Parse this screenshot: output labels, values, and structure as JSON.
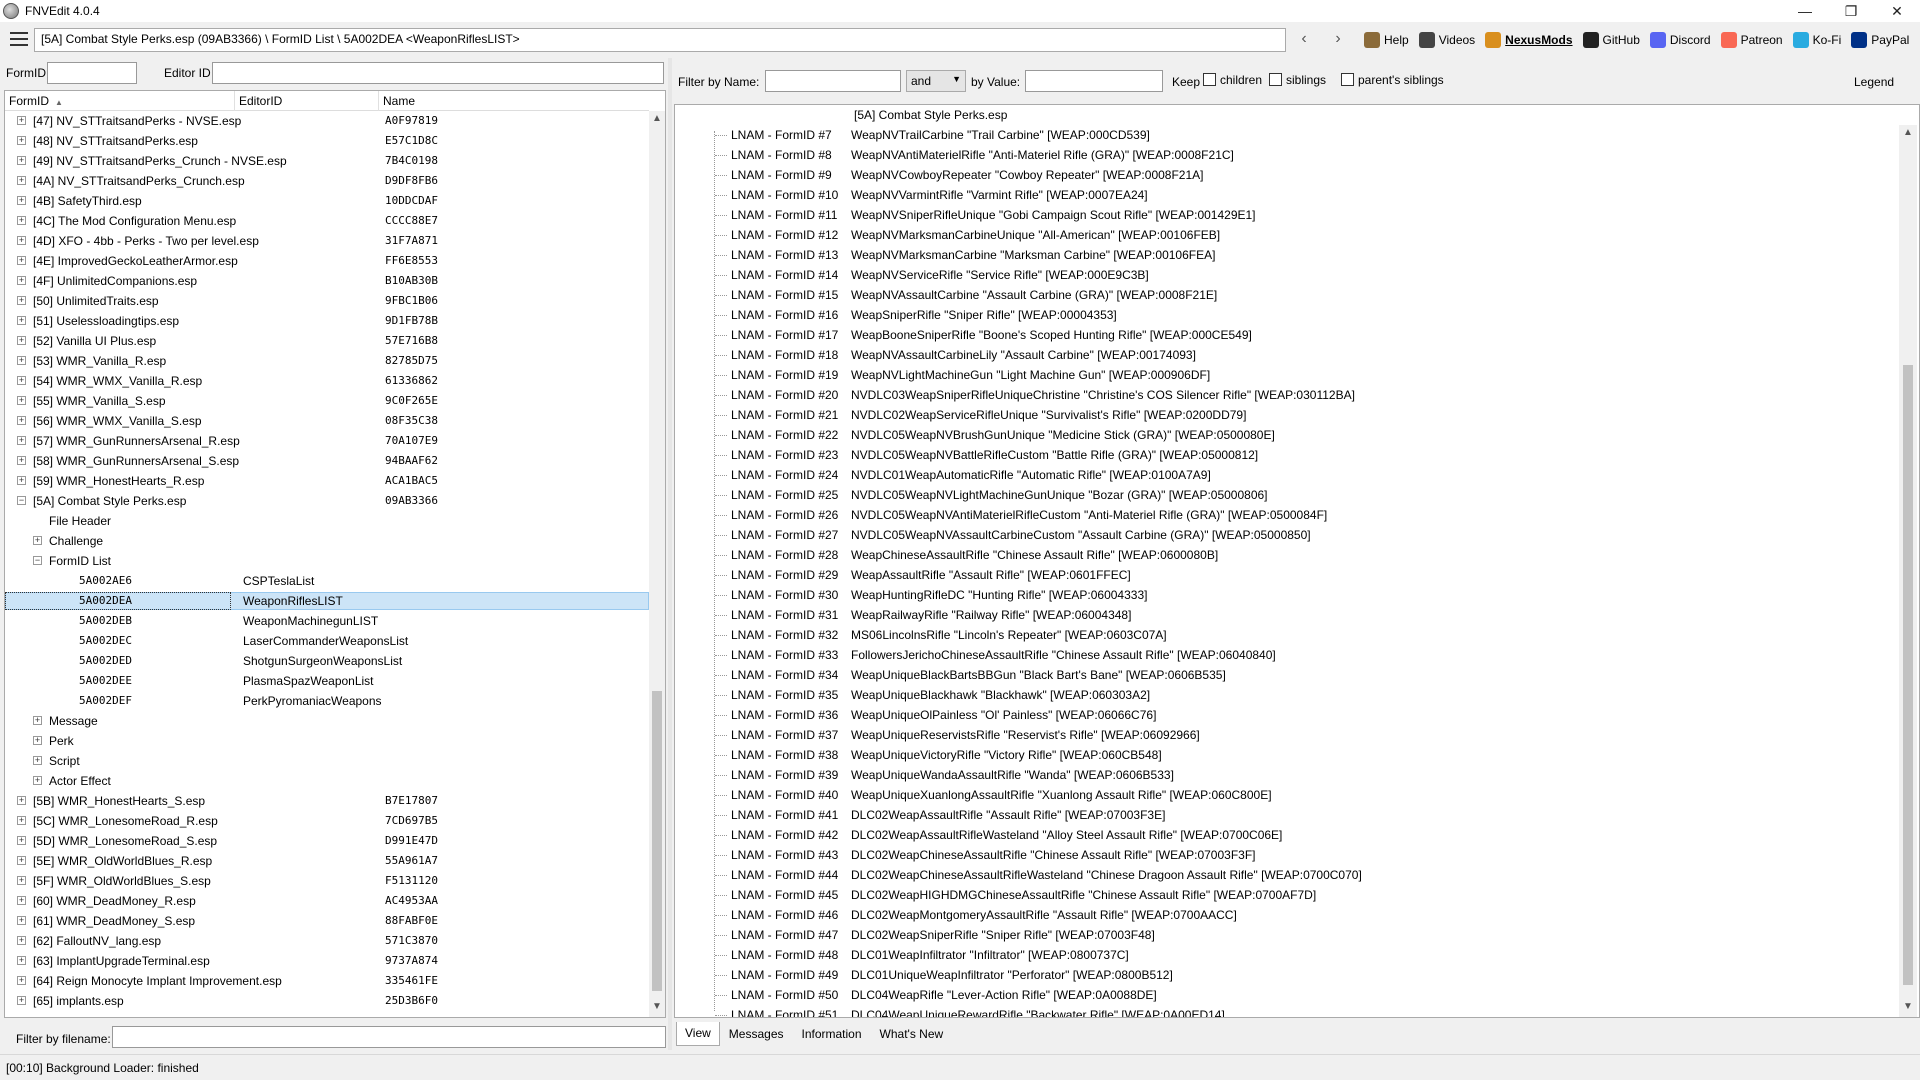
{
  "window": {
    "title": "FNVEdit 4.0.4",
    "controls": [
      "—",
      "❐",
      "✕"
    ]
  },
  "toolbar": {
    "path": "[5A] Combat Style Perks.esp (09AB3366) \\ FormID List \\ 5A002DEA <WeaponRiflesLIST>",
    "back": "‹",
    "forward": "›",
    "links": [
      {
        "label": "Help",
        "icon": "book-icon",
        "color": "#8b6b3a"
      },
      {
        "label": "Videos",
        "icon": "film-icon",
        "color": "#444444"
      },
      {
        "label": "NexusMods",
        "icon": "nexus-icon",
        "color": "#d98f1e"
      },
      {
        "label": "GitHub",
        "icon": "github-icon",
        "color": "#222222"
      },
      {
        "label": "Discord",
        "icon": "discord-icon",
        "color": "#5865f2"
      },
      {
        "label": "Patreon",
        "icon": "patreon-icon",
        "color": "#f96854"
      },
      {
        "label": "Ko-Fi",
        "icon": "kofi-icon",
        "color": "#29abe0"
      },
      {
        "label": "PayPal",
        "icon": "paypal-icon",
        "color": "#003087"
      }
    ]
  },
  "left": {
    "formid_label": "FormID",
    "editorid_label": "Editor ID",
    "columns": [
      "FormID",
      "EditorID",
      "Name"
    ],
    "filter_label": "Filter by filename:",
    "rows": [
      {
        "lvl": 0,
        "exp": "+",
        "text": "[47] NV_STTraitsandPerks - NVSE.esp",
        "val": "A0F97819"
      },
      {
        "lvl": 0,
        "exp": "+",
        "text": "[48] NV_STTraitsandPerks.esp",
        "val": "E57C1D8C"
      },
      {
        "lvl": 0,
        "exp": "+",
        "text": "[49] NV_STTraitsandPerks_Crunch - NVSE.esp",
        "val": "7B4C0198"
      },
      {
        "lvl": 0,
        "exp": "+",
        "text": "[4A] NV_STTraitsandPerks_Crunch.esp",
        "val": "D9DF8FB6"
      },
      {
        "lvl": 0,
        "exp": "+",
        "text": "[4B] SafetyThird.esp",
        "val": "10DDCDAF"
      },
      {
        "lvl": 0,
        "exp": "+",
        "text": "[4C] The Mod Configuration Menu.esp",
        "val": "CCCC88E7"
      },
      {
        "lvl": 0,
        "exp": "+",
        "text": "[4D] XFO - 4bb - Perks - Two per level.esp",
        "val": "31F7A871"
      },
      {
        "lvl": 0,
        "exp": "+",
        "text": "[4E] ImprovedGeckoLeatherArmor.esp",
        "val": "FF6E8553"
      },
      {
        "lvl": 0,
        "exp": "+",
        "text": "[4F] UnlimitedCompanions.esp",
        "val": "B10AB30B"
      },
      {
        "lvl": 0,
        "exp": "+",
        "text": "[50] UnlimitedTraits.esp",
        "val": "9FBC1B06"
      },
      {
        "lvl": 0,
        "exp": "+",
        "text": "[51] Uselessloadingtips.esp",
        "val": "9D1FB78B"
      },
      {
        "lvl": 0,
        "exp": "+",
        "text": "[52] Vanilla UI Plus.esp",
        "val": "57E716B8"
      },
      {
        "lvl": 0,
        "exp": "+",
        "text": "[53] WMR_Vanilla_R.esp",
        "val": "82785D75"
      },
      {
        "lvl": 0,
        "exp": "+",
        "text": "[54] WMR_WMX_Vanilla_R.esp",
        "val": "61336862"
      },
      {
        "lvl": 0,
        "exp": "+",
        "text": "[55] WMR_Vanilla_S.esp",
        "val": "9C0F265E"
      },
      {
        "lvl": 0,
        "exp": "+",
        "text": "[56] WMR_WMX_Vanilla_S.esp",
        "val": "08F35C38"
      },
      {
        "lvl": 0,
        "exp": "+",
        "text": "[57] WMR_GunRunnersArsenal_R.esp",
        "val": "70A107E9"
      },
      {
        "lvl": 0,
        "exp": "+",
        "text": "[58] WMR_GunRunnersArsenal_S.esp",
        "val": "94BAAF62"
      },
      {
        "lvl": 0,
        "exp": "+",
        "text": "[59] WMR_HonestHearts_R.esp",
        "val": "ACA1BAC5"
      },
      {
        "lvl": 0,
        "exp": "−",
        "text": "[5A] Combat Style Perks.esp",
        "val": "09AB3366"
      },
      {
        "lvl": 1,
        "exp": "",
        "text": "File Header",
        "val": ""
      },
      {
        "lvl": 1,
        "exp": "+",
        "text": "Challenge",
        "val": ""
      },
      {
        "lvl": 1,
        "exp": "−",
        "text": "FormID List",
        "val": ""
      },
      {
        "lvl": 2,
        "exp": "",
        "text": "5A002AE6",
        "eid": "CSPTeslaList",
        "val": "",
        "mono": true
      },
      {
        "lvl": 2,
        "exp": "",
        "text": "5A002DEA",
        "eid": "WeaponRiflesLIST",
        "val": "",
        "mono": true,
        "sel": true
      },
      {
        "lvl": 2,
        "exp": "",
        "text": "5A002DEB",
        "eid": "WeaponMachinegunLIST",
        "val": "",
        "mono": true
      },
      {
        "lvl": 2,
        "exp": "",
        "text": "5A002DEC",
        "eid": "LaserCommanderWeaponsList",
        "val": "",
        "mono": true
      },
      {
        "lvl": 2,
        "exp": "",
        "text": "5A002DED",
        "eid": "ShotgunSurgeonWeaponsList",
        "val": "",
        "mono": true
      },
      {
        "lvl": 2,
        "exp": "",
        "text": "5A002DEE",
        "eid": "PlasmaSpazWeaponList",
        "val": "",
        "mono": true
      },
      {
        "lvl": 2,
        "exp": "",
        "text": "5A002DEF",
        "eid": "PerkPyromaniacWeapons",
        "val": "",
        "mono": true
      },
      {
        "lvl": 1,
        "exp": "+",
        "text": "Message",
        "val": ""
      },
      {
        "lvl": 1,
        "exp": "+",
        "text": "Perk",
        "val": ""
      },
      {
        "lvl": 1,
        "exp": "+",
        "text": "Script",
        "val": ""
      },
      {
        "lvl": 1,
        "exp": "+",
        "text": "Actor Effect",
        "val": ""
      },
      {
        "lvl": 0,
        "exp": "+",
        "text": "[5B] WMR_HonestHearts_S.esp",
        "val": "B7E17807"
      },
      {
        "lvl": 0,
        "exp": "+",
        "text": "[5C] WMR_LonesomeRoad_R.esp",
        "val": "7CD697B5"
      },
      {
        "lvl": 0,
        "exp": "+",
        "text": "[5D] WMR_LonesomeRoad_S.esp",
        "val": "D991E47D"
      },
      {
        "lvl": 0,
        "exp": "+",
        "text": "[5E] WMR_OldWorldBlues_R.esp",
        "val": "55A961A7"
      },
      {
        "lvl": 0,
        "exp": "+",
        "text": "[5F] WMR_OldWorldBlues_S.esp",
        "val": "F5131120"
      },
      {
        "lvl": 0,
        "exp": "+",
        "text": "[60] WMR_DeadMoney_R.esp",
        "val": "AC4953AA"
      },
      {
        "lvl": 0,
        "exp": "+",
        "text": "[61] WMR_DeadMoney_S.esp",
        "val": "88FABF0E"
      },
      {
        "lvl": 0,
        "exp": "+",
        "text": "[62] FalloutNV_lang.esp",
        "val": "571C3870"
      },
      {
        "lvl": 0,
        "exp": "+",
        "text": "[63] ImplantUpgradeTerminal.esp",
        "val": "9737A874"
      },
      {
        "lvl": 0,
        "exp": "+",
        "text": "[64] Reign Monocyte Implant Improvement.esp",
        "val": "335461FE"
      },
      {
        "lvl": 0,
        "exp": "+",
        "text": "[65] implants.esp",
        "val": "25D3B6F0"
      }
    ]
  },
  "right": {
    "filter_name_label": "Filter by Name:",
    "and_value": "and",
    "filter_value_label": "by Value:",
    "keep_label": "Keep",
    "chk_children": "children",
    "chk_siblings": "siblings",
    "chk_parents": "parent's siblings",
    "legend": "Legend",
    "header": "[5A] Combat Style Perks.esp",
    "rows": [
      {
        "k": "LNAM - FormID #7",
        "v": "WeapNVTrailCarbine \"Trail Carbine\" [WEAP:000CD539]"
      },
      {
        "k": "LNAM - FormID #8",
        "v": "WeapNVAntiMaterielRifle \"Anti-Materiel Rifle (GRA)\" [WEAP:0008F21C]"
      },
      {
        "k": "LNAM - FormID #9",
        "v": "WeapNVCowboyRepeater \"Cowboy Repeater\" [WEAP:0008F21A]"
      },
      {
        "k": "LNAM - FormID #10",
        "v": "WeapNVVarmintRifle \"Varmint Rifle\" [WEAP:0007EA24]"
      },
      {
        "k": "LNAM - FormID #11",
        "v": "WeapNVSniperRifleUnique \"Gobi Campaign Scout Rifle\" [WEAP:001429E1]"
      },
      {
        "k": "LNAM - FormID #12",
        "v": "WeapNVMarksmanCarbineUnique \"All-American\" [WEAP:00106FEB]"
      },
      {
        "k": "LNAM - FormID #13",
        "v": "WeapNVMarksmanCarbine \"Marksman Carbine\" [WEAP:00106FEA]"
      },
      {
        "k": "LNAM - FormID #14",
        "v": "WeapNVServiceRifle \"Service Rifle\" [WEAP:000E9C3B]"
      },
      {
        "k": "LNAM - FormID #15",
        "v": "WeapNVAssaultCarbine \"Assault Carbine (GRA)\" [WEAP:0008F21E]"
      },
      {
        "k": "LNAM - FormID #16",
        "v": "WeapSniperRifle \"Sniper Rifle\" [WEAP:00004353]"
      },
      {
        "k": "LNAM - FormID #17",
        "v": "WeapBooneSniperRifle \"Boone's Scoped Hunting Rifle\" [WEAP:000CE549]"
      },
      {
        "k": "LNAM - FormID #18",
        "v": "WeapNVAssaultCarbineLily \"Assault Carbine\" [WEAP:00174093]"
      },
      {
        "k": "LNAM - FormID #19",
        "v": "WeapNVLightMachineGun \"Light Machine Gun\" [WEAP:000906DF]"
      },
      {
        "k": "LNAM - FormID #20",
        "v": "NVDLC03WeapSniperRifleUniqueChristine \"Christine's COS Silencer Rifle\" [WEAP:030112BA]"
      },
      {
        "k": "LNAM - FormID #21",
        "v": "NVDLC02WeapServiceRifleUnique \"Survivalist's Rifle\" [WEAP:0200DD79]"
      },
      {
        "k": "LNAM - FormID #22",
        "v": "NVDLC05WeapNVBrushGunUnique \"Medicine Stick (GRA)\" [WEAP:0500080E]"
      },
      {
        "k": "LNAM - FormID #23",
        "v": "NVDLC05WeapNVBattleRifleCustom \"Battle Rifle (GRA)\" [WEAP:05000812]"
      },
      {
        "k": "LNAM - FormID #24",
        "v": "NVDLC01WeapAutomaticRifle \"Automatic Rifle\" [WEAP:0100A7A9]"
      },
      {
        "k": "LNAM - FormID #25",
        "v": "NVDLC05WeapNVLightMachineGunUnique \"Bozar (GRA)\" [WEAP:05000806]"
      },
      {
        "k": "LNAM - FormID #26",
        "v": "NVDLC05WeapNVAntiMaterielRifleCustom \"Anti-Materiel Rifle (GRA)\" [WEAP:0500084F]"
      },
      {
        "k": "LNAM - FormID #27",
        "v": "NVDLC05WeapNVAssaultCarbineCustom \"Assault Carbine (GRA)\" [WEAP:05000850]"
      },
      {
        "k": "LNAM - FormID #28",
        "v": "WeapChineseAssaultRifle \"Chinese Assault Rifle\" [WEAP:0600080B]"
      },
      {
        "k": "LNAM - FormID #29",
        "v": "WeapAssaultRifle \"Assault Rifle\" [WEAP:0601FFEC]"
      },
      {
        "k": "LNAM - FormID #30",
        "v": "WeapHuntingRifleDC \"Hunting Rifle\" [WEAP:06004333]"
      },
      {
        "k": "LNAM - FormID #31",
        "v": "WeapRailwayRifle \"Railway Rifle\" [WEAP:06004348]"
      },
      {
        "k": "LNAM - FormID #32",
        "v": "MS06LincolnsRifle \"Lincoln's Repeater\" [WEAP:0603C07A]"
      },
      {
        "k": "LNAM - FormID #33",
        "v": "FollowersJerichoChineseAssaultRifle \"Chinese Assault Rifle\" [WEAP:06040840]"
      },
      {
        "k": "LNAM - FormID #34",
        "v": "WeapUniqueBlackBartsBBGun \"Black Bart's Bane\" [WEAP:0606B535]"
      },
      {
        "k": "LNAM - FormID #35",
        "v": "WeapUniqueBlackhawk \"Blackhawk\" [WEAP:060303A2]"
      },
      {
        "k": "LNAM - FormID #36",
        "v": "WeapUniqueOlPainless \"Ol' Painless\" [WEAP:06066C76]"
      },
      {
        "k": "LNAM - FormID #37",
        "v": "WeapUniqueReservistsRifle \"Reservist's Rifle\" [WEAP:06092966]"
      },
      {
        "k": "LNAM - FormID #38",
        "v": "WeapUniqueVictoryRifle \"Victory Rifle\" [WEAP:060CB548]"
      },
      {
        "k": "LNAM - FormID #39",
        "v": "WeapUniqueWandaAssaultRifle \"Wanda\" [WEAP:0606B533]"
      },
      {
        "k": "LNAM - FormID #40",
        "v": "WeapUniqueXuanlongAssaultRifle \"Xuanlong Assault Rifle\" [WEAP:060C800E]"
      },
      {
        "k": "LNAM - FormID #41",
        "v": "DLC02WeapAssaultRifle \"Assault Rifle\" [WEAP:07003F3E]"
      },
      {
        "k": "LNAM - FormID #42",
        "v": "DLC02WeapAssaultRifleWasteland \"Alloy Steel Assault Rifle\" [WEAP:0700C06E]"
      },
      {
        "k": "LNAM - FormID #43",
        "v": "DLC02WeapChineseAssaultRifle \"Chinese Assault Rifle\" [WEAP:07003F3F]"
      },
      {
        "k": "LNAM - FormID #44",
        "v": "DLC02WeapChineseAssaultRifleWasteland \"Chinese Dragoon Assault Rifle\" [WEAP:0700C070]"
      },
      {
        "k": "LNAM - FormID #45",
        "v": "DLC02WeapHIGHDMGChineseAssaultRifle \"Chinese Assault Rifle\" [WEAP:0700AF7D]"
      },
      {
        "k": "LNAM - FormID #46",
        "v": "DLC02WeapMontgomeryAssaultRifle \"Assault Rifle\" [WEAP:0700AACC]"
      },
      {
        "k": "LNAM - FormID #47",
        "v": "DLC02WeapSniperRifle \"Sniper Rifle\" [WEAP:07003F48]"
      },
      {
        "k": "LNAM - FormID #48",
        "v": "DLC01WeapInfiltrator \"Infiltrator\" [WEAP:0800737C]"
      },
      {
        "k": "LNAM - FormID #49",
        "v": "DLC01UniqueWeapInfiltrator \"Perforator\" [WEAP:0800B512]"
      },
      {
        "k": "LNAM - FormID #50",
        "v": "DLC04WeapRifle \"Lever-Action Rifle\" [WEAP:0A0088DE]"
      },
      {
        "k": "LNAM - FormID #51",
        "v": "DLC04WeapUniqueRewardRifle \"Backwater Rifle\" [WEAP:0A00ED14]"
      }
    ],
    "tabs": [
      "View",
      "Messages",
      "Information",
      "What's New"
    ]
  },
  "status": "[00:10] Background Loader: finished"
}
